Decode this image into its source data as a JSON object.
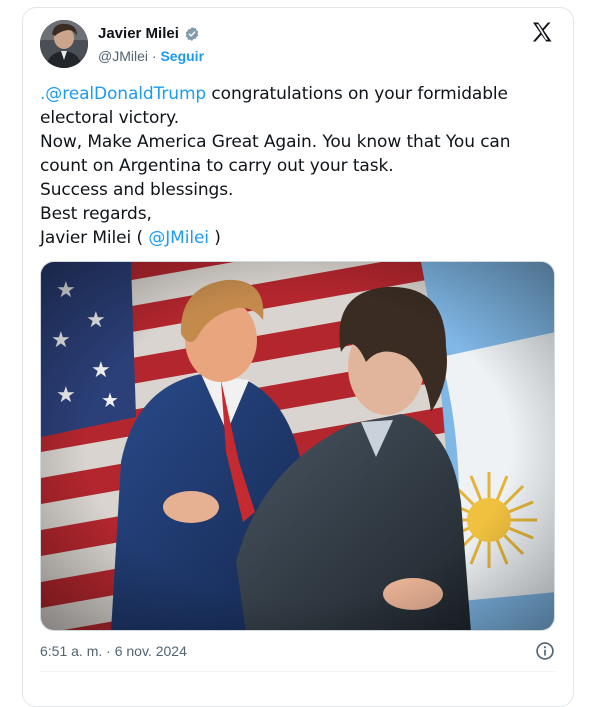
{
  "author": {
    "name": "Javier Milei",
    "handle": "@JMilei",
    "separator": "·",
    "follow_label": "Seguir"
  },
  "icons": {
    "verified": "verified-badge-icon",
    "platform": "x-logo-icon",
    "info": "info-icon"
  },
  "colors": {
    "accent": "#1d9bf0",
    "text": "#0f1419",
    "secondary": "#536471"
  },
  "tweet": {
    "mention_trump": ".@realDonaldTrump",
    "line1_rest": " congratulations on your formidable",
    "line2": "electoral victory.",
    "line3": "Now, Make America Great Again. You know that You can",
    "line4": "count on Argentina to carry out your task.",
    "line5": "Success and blessings.",
    "line6": "Best regards,",
    "line7_prefix": "Javier Milei ( ",
    "mention_milei": "@JMilei",
    "line7_suffix": " )"
  },
  "timestamp": {
    "time": "6:51 a. m.",
    "separator": " · ",
    "date": "6 nov. 2024"
  }
}
